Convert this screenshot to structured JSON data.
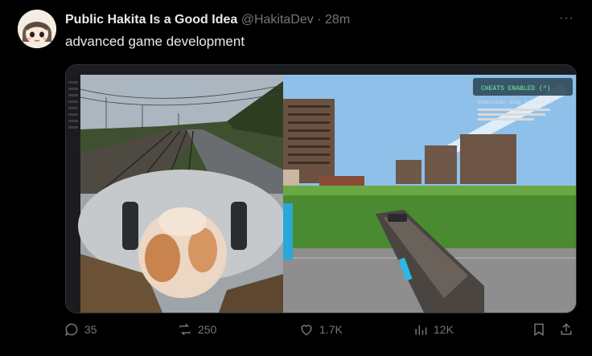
{
  "tweet": {
    "display_name": "Public Hakita Is a Good Idea",
    "handle": "@HakitaDev",
    "separator": "·",
    "time": "28m",
    "text": "advanced game development",
    "more": "···"
  },
  "media": {
    "hud_label": "CHEATS ENABLED (^)",
    "hud_sub": "Dimension: Gray 16 Level 0"
  },
  "actions": {
    "replies": "35",
    "reposts": "250",
    "likes": "1.7K",
    "views": "12K"
  },
  "colors": {
    "background": "#000000",
    "muted": "#71767b",
    "text": "#e7e9ea"
  }
}
